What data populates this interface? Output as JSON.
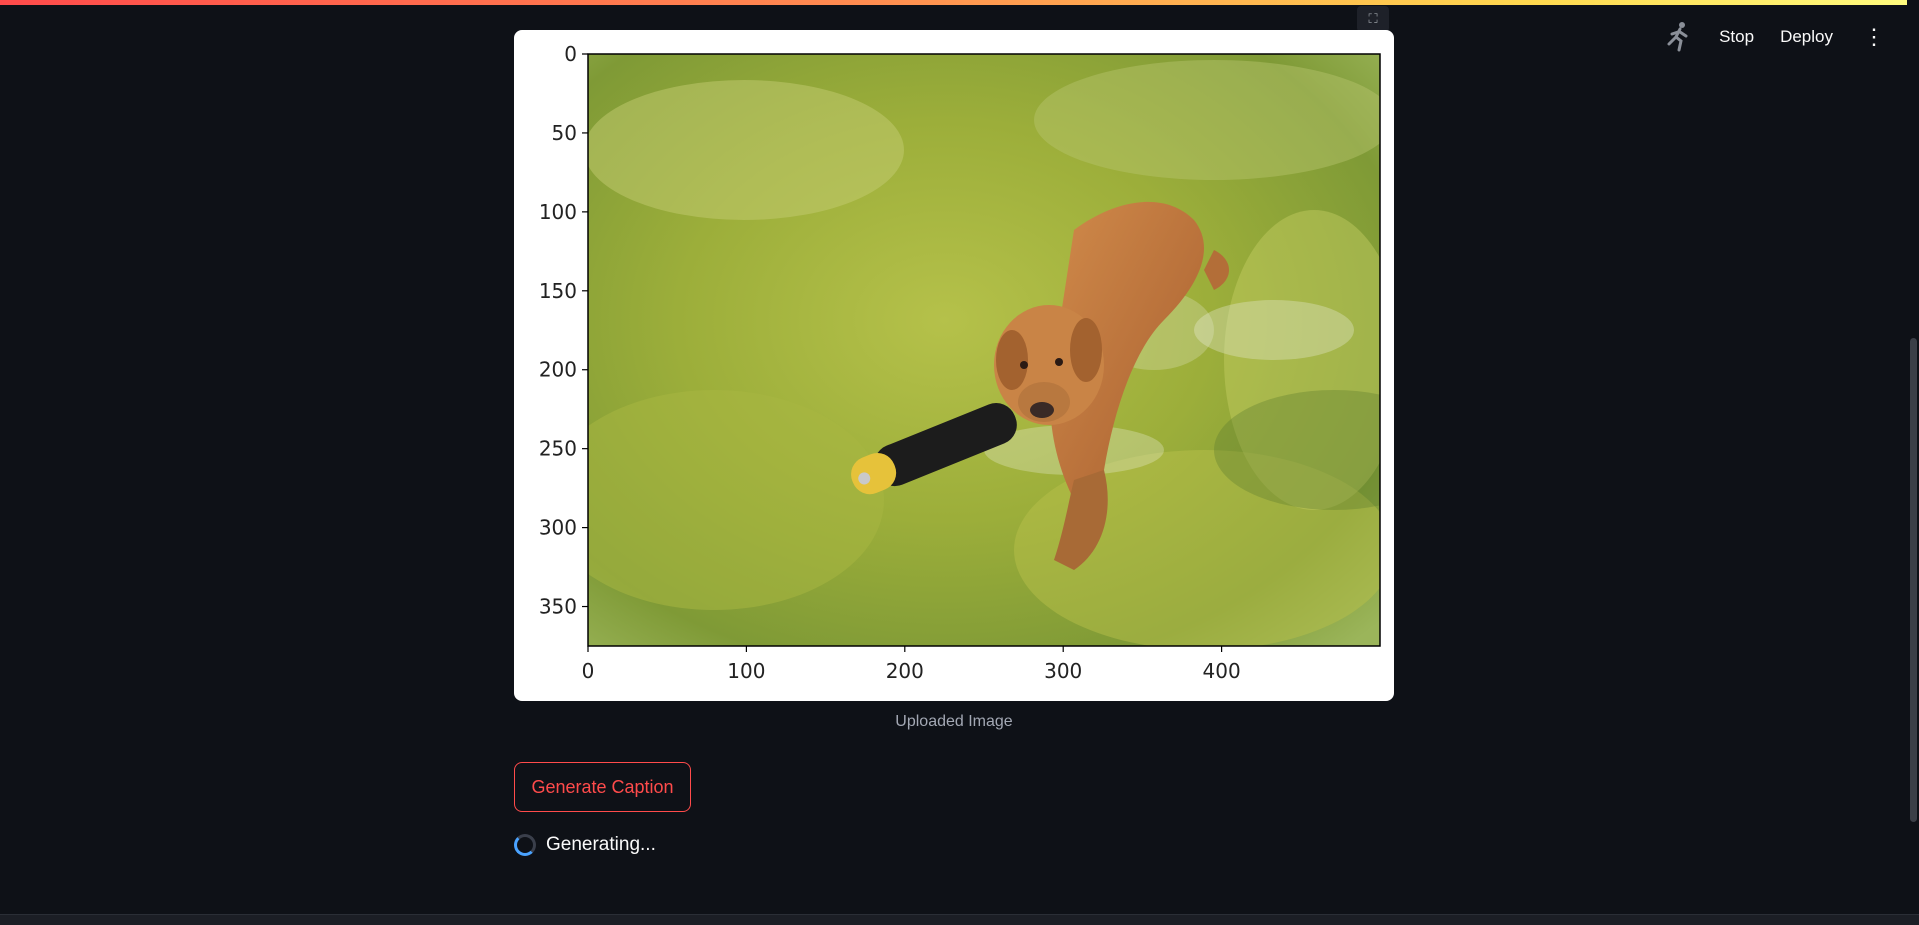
{
  "header": {
    "running_icon": "running-man-icon",
    "stop_label": "Stop",
    "deploy_label": "Deploy",
    "menu_icon": "vertical-dots-icon"
  },
  "figure": {
    "fullscreen_icon": "expand-icon",
    "image_subject": "golden retriever wading through shallow green water carrying a black and yellow dummy toy",
    "caption": "Uploaded Image"
  },
  "chart_data": {
    "type": "image",
    "xticks": [
      "0",
      "100",
      "200",
      "300",
      "400"
    ],
    "yticks": [
      "0",
      "50",
      "100",
      "150",
      "200",
      "250",
      "300",
      "350"
    ],
    "xlim": [
      0,
      500
    ],
    "ylim": [
      375,
      0
    ]
  },
  "actions": {
    "generate_label": "Generate Caption",
    "status_text": "Generating..."
  },
  "colors": {
    "background": "#0e1117",
    "accent": "#ff4b4b",
    "spinner": "#4aa3ff"
  }
}
